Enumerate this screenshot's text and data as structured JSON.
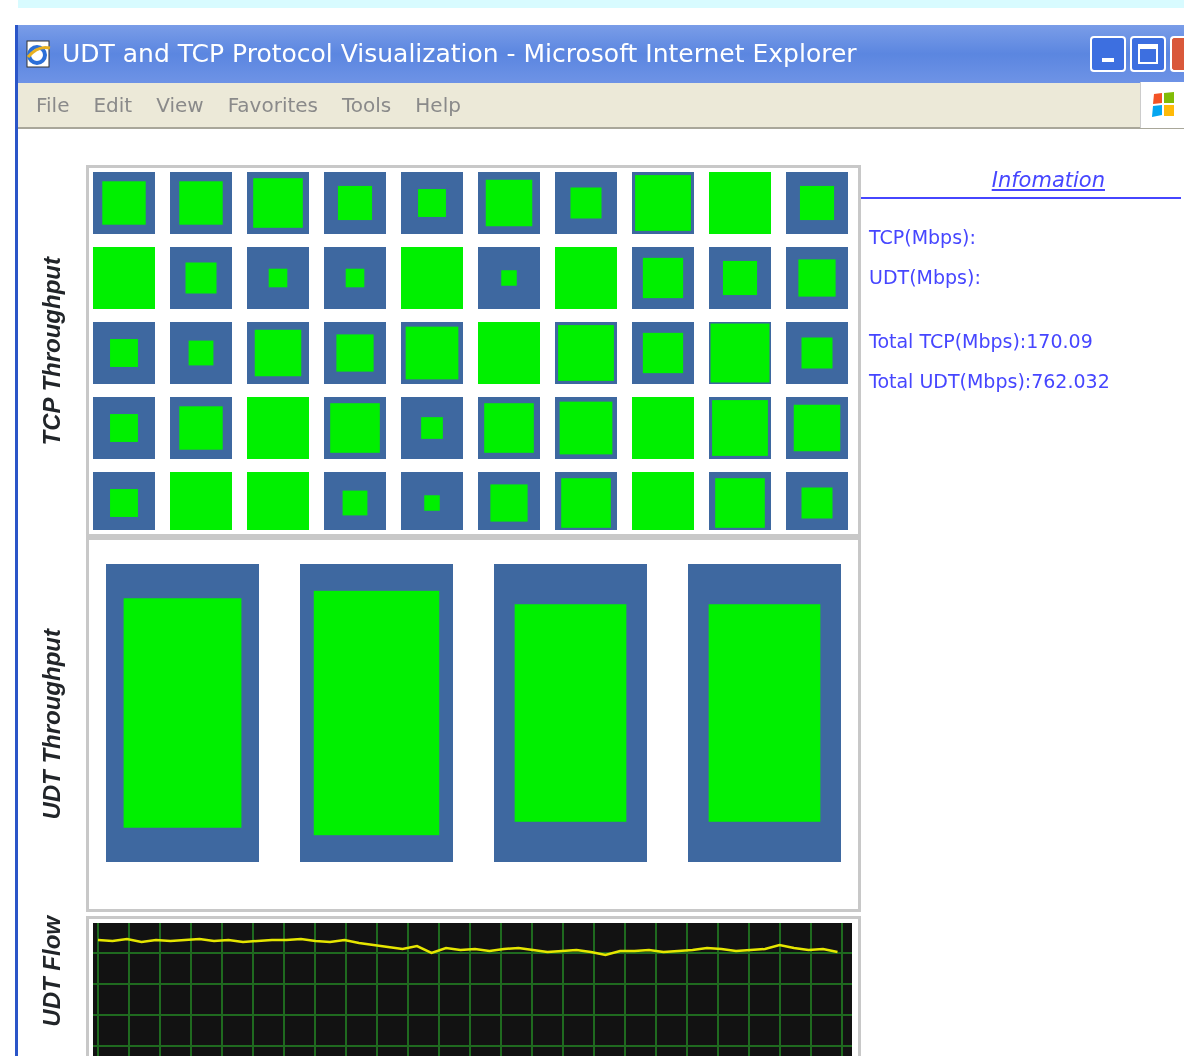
{
  "window": {
    "title": "UDT and TCP Protocol Visualization - Microsoft Internet Explorer"
  },
  "menu": [
    "File",
    "Edit",
    "View",
    "Favorites",
    "Tools",
    "Help"
  ],
  "tcp_panel": {
    "label": "TCP Throughput"
  },
  "udt_panel": {
    "label": "UDT Throughput"
  },
  "flow_panel": {
    "label": "UDT Flow"
  },
  "info": {
    "title": "Infomation",
    "rates": [
      "TCP(Mbps):",
      "UDT(Mbps):"
    ],
    "totals": [
      "Total TCP(Mbps):170.09",
      "Total UDT(Mbps):762.032"
    ]
  }
}
